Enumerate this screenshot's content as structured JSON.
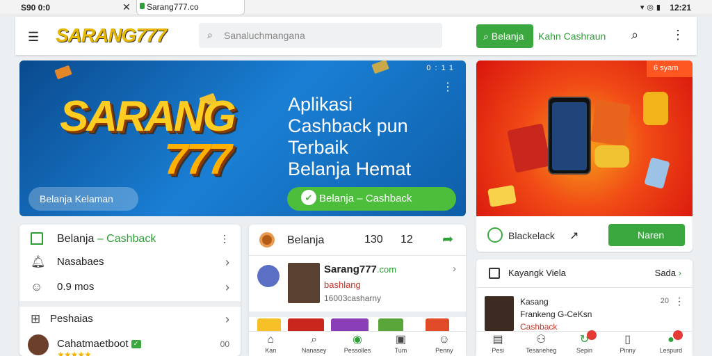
{
  "statusbar": {
    "left_text": "S90 0:0",
    "url": "Sarang777.co",
    "time": "12:21"
  },
  "topbar": {
    "logo": "SARANG777",
    "search_placeholder": "Sanaluchmangana",
    "belanja_button": "Belanja",
    "cashback_link": "Kahn Cashraun"
  },
  "hero": {
    "logo_line1": "SARANG",
    "logo_line2": "777",
    "status_text": "0:11",
    "headline_lines": [
      "Aplikasi",
      "Cashback pun",
      "Terbaik",
      "Belanja Hemat"
    ],
    "pill_label": "Belanja Kelaman",
    "cta_label": "Belanja – Cashback"
  },
  "promo": {
    "badge": "6 syam",
    "footer_label": "Blackelack",
    "footer_button": "Naren"
  },
  "card1": {
    "title": "Belanja",
    "title_accent": "– Cashback",
    "rows": [
      {
        "label": "Nasabaes"
      },
      {
        "label": "0.9 mos"
      },
      {
        "label": "Peshaias"
      },
      {
        "label": "Cahatmaetboot"
      }
    ],
    "badge": "00"
  },
  "card2": {
    "title": "Belanja",
    "num1": "130",
    "num2": "12",
    "item_title": "Sarang777",
    "item_domain": ".com",
    "item_sub": "bashlang",
    "item_meta": "16003casharny"
  },
  "card3": {
    "title": "Kayangk Viela",
    "more": "Sada",
    "item_line1": "Kasang",
    "item_line2": "Frankeng G-CeKsn",
    "item_line3": "Cashback",
    "item_num": "20"
  },
  "nav1": {
    "items": [
      {
        "label": "Kan",
        "icon": "home-icon"
      },
      {
        "label": "Nanasey",
        "icon": "search-icon"
      },
      {
        "label": "Pessolles",
        "icon": "gift-icon"
      },
      {
        "label": "Tum",
        "icon": "tablet-icon"
      },
      {
        "label": "Penny",
        "icon": "user-icon"
      }
    ]
  },
  "nav2": {
    "items": [
      {
        "label": "Pesi",
        "icon": "document-icon"
      },
      {
        "label": "Tesaneheg",
        "icon": "people-icon"
      },
      {
        "label": "Sepin",
        "icon": "refresh-icon"
      },
      {
        "label": "Pinny",
        "icon": "phone-icon"
      },
      {
        "label": "Lespurd",
        "icon": "chat-icon"
      }
    ]
  },
  "colors": {
    "brand_green": "#3aa83e",
    "brand_blue": "#1a7fd4",
    "brand_red": "#e53935"
  }
}
